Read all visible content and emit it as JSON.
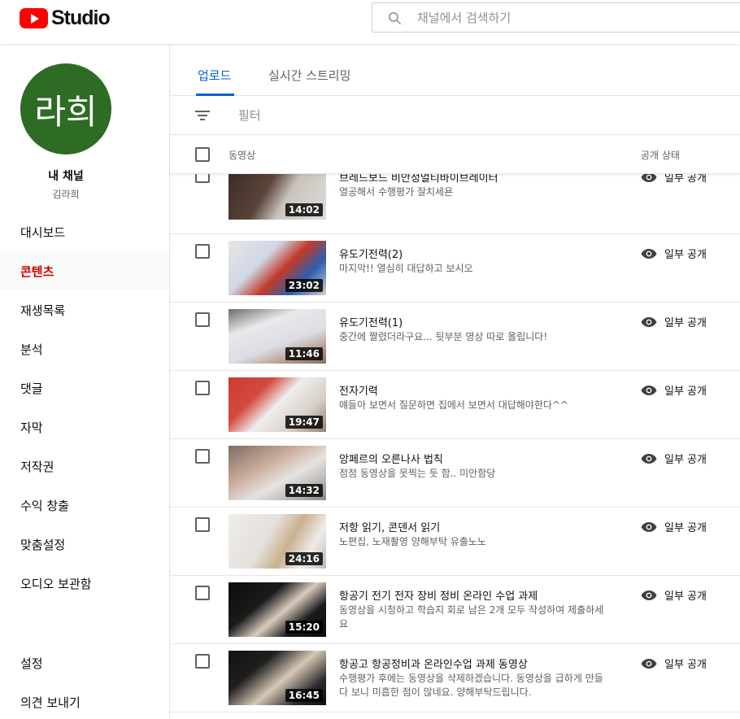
{
  "header": {
    "logo_text": "Studio",
    "search_placeholder": "채널에서 검색하기"
  },
  "sidebar": {
    "avatar_text": "라희",
    "channel_title": "내 채널",
    "channel_name": "김라희",
    "items": [
      {
        "label": "대시보드",
        "active": false
      },
      {
        "label": "콘텐츠",
        "active": true
      },
      {
        "label": "재생목록",
        "active": false
      },
      {
        "label": "분석",
        "active": false
      },
      {
        "label": "댓글",
        "active": false
      },
      {
        "label": "자막",
        "active": false
      },
      {
        "label": "저작권",
        "active": false
      },
      {
        "label": "수익 창출",
        "active": false
      },
      {
        "label": "맞춤설정",
        "active": false
      },
      {
        "label": "오디오 보관함",
        "active": false
      }
    ],
    "bottom_items": [
      {
        "label": "설정"
      },
      {
        "label": "의견 보내기"
      }
    ]
  },
  "tabs": [
    {
      "label": "업로드",
      "active": true
    },
    {
      "label": "실시간 스트리밍",
      "active": false
    }
  ],
  "filter": {
    "label": "필터"
  },
  "columns": {
    "video": "동영상",
    "visibility": "공개 상태"
  },
  "visibility_label": "일부 공개",
  "videos": [
    {
      "title": "브레드보드 비안정멀티바이브레이터",
      "desc": "열공해서 수행평가 잘치세욘",
      "duration": "14:02"
    },
    {
      "title": "유도기전력(2)",
      "desc": "마지막!! 열심히 대답하고 보시오",
      "duration": "23:02"
    },
    {
      "title": "유도기전력(1)",
      "desc": "중간에 짤렸더라구요... 뒷부분 영상 따로 올립니다!",
      "duration": "11:46"
    },
    {
      "title": "전자기력",
      "desc": "얘들아 보면서 질문하면 집에서 보면서 대답해야한다^^",
      "duration": "19:47"
    },
    {
      "title": "앙페르의 오른나사 법칙",
      "desc": "점점 동영상을 못찍는 듯 함.. 미안함당",
      "duration": "14:32"
    },
    {
      "title": "저항 읽기, 콘덴서 읽기",
      "desc": "노편집, 노재촬영 양해부탁 유출노노",
      "duration": "24:16"
    },
    {
      "title": "항공기 전기 전자 장비 정비 온라인 수업 과제",
      "desc": "동영상을 시청하고 학습지 회로 남은 2개 모두 작성하여 제출하세요",
      "duration": "15:20"
    },
    {
      "title": "항공고 항공정비과 온라인수업 과제 동영상",
      "desc": "수행평가 후에는 동영상을 삭제하겠습니다. 동영상을 급하게 만들다 보니 미흡한 점이 많네요. 양해부탁드립니다.",
      "duration": "16:45"
    }
  ]
}
